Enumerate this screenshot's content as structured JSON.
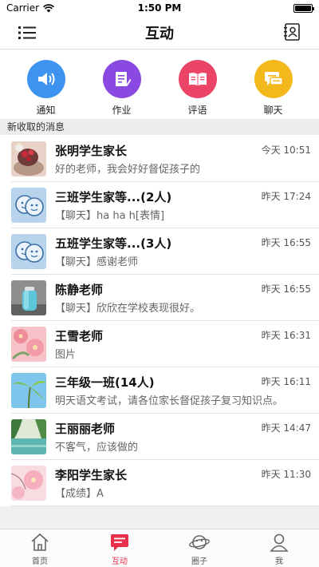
{
  "status_bar": {
    "carrier": "Carrier",
    "time": "1:50 PM",
    "battery_level": 1.0
  },
  "nav": {
    "title": "互动",
    "left_icon": "menu-list-icon",
    "right_icon": "contacts-book-icon"
  },
  "shortcuts": [
    {
      "label": "通知",
      "icon": "speaker-icon",
      "color": "#3f93f0"
    },
    {
      "label": "作业",
      "icon": "homework-icon",
      "color": "#8a49e0"
    },
    {
      "label": "评语",
      "icon": "book-icon",
      "color": "#ec4466"
    },
    {
      "label": "聊天",
      "icon": "chat-icon",
      "color": "#f3b81c"
    }
  ],
  "section_header": "新收取的消息",
  "messages": [
    {
      "name": "张明学生家长",
      "time": "今天 10:51",
      "preview": "好的老师，我会好好督促孩子的"
    },
    {
      "name": "三班学生家等...(2人)",
      "time": "昨天 17:24",
      "preview": "【聊天】ha ha h[表情]"
    },
    {
      "name": "五班学生家等...(3人)",
      "time": "昨天 16:55",
      "preview": "【聊天】感谢老师"
    },
    {
      "name": "陈静老师",
      "time": "昨天 16:55",
      "preview": "【聊天】欣欣在学校表现很好。"
    },
    {
      "name": "王雪老师",
      "time": "昨天 16:31",
      "preview": "图片"
    },
    {
      "name": "三年级一班(14人)",
      "time": "昨天 16:11",
      "preview": "明天语文考试，请各位家长督促孩子复习知识点。"
    },
    {
      "name": "王丽丽老师",
      "time": "昨天 14:47",
      "preview": "不客气，应该做的"
    },
    {
      "name": "李阳学生家长",
      "time": "昨天 11:30",
      "preview": "【成绩】A"
    }
  ],
  "tabs": [
    {
      "label": "首页",
      "icon": "home-icon",
      "active": false
    },
    {
      "label": "互动",
      "icon": "message-icon",
      "active": true
    },
    {
      "label": "圈子",
      "icon": "planet-icon",
      "active": false
    },
    {
      "label": "我",
      "icon": "user-icon",
      "active": false
    }
  ],
  "colors": {
    "accent": "#e8304d"
  }
}
